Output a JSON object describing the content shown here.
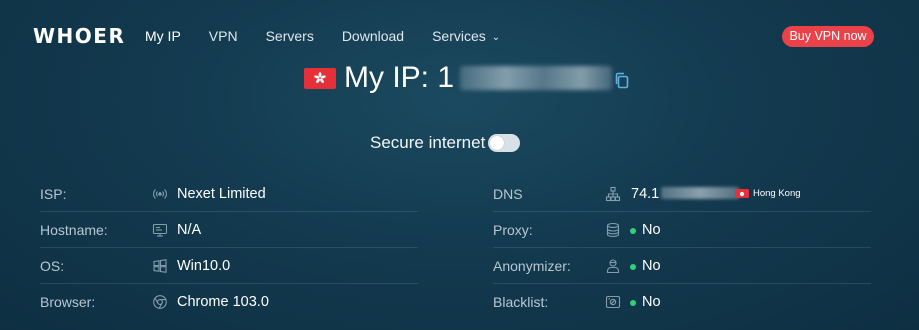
{
  "brand": {
    "logo": "WHOER"
  },
  "nav": {
    "items": [
      {
        "label": "My IP",
        "active": true
      },
      {
        "label": "VPN"
      },
      {
        "label": "Servers"
      },
      {
        "label": "Download"
      },
      {
        "label": "Services"
      }
    ],
    "services_chevron_icon": "chevron-down-icon",
    "cta": "Buy VPN now"
  },
  "ip": {
    "title": "My IP: 1",
    "flag_icon": "flag-hong-kong-icon",
    "copy_icon": "copy-icon"
  },
  "secure": {
    "label": "Secure internet",
    "enabled": false
  },
  "info": {
    "left": [
      {
        "label": "ISP:",
        "value": "Nexet Limited",
        "icon": "signal-icon"
      },
      {
        "label": "Hostname:",
        "value": "N/A",
        "icon": "server-screen-icon"
      },
      {
        "label": "OS:",
        "value": "Win10.0",
        "icon": "windows-icon"
      },
      {
        "label": "Browser:",
        "value": "Chrome 103.0",
        "icon": "browser-icon"
      }
    ],
    "right": [
      {
        "label": "DNS",
        "value": "74.1",
        "icon": "network-icon",
        "country": "Hong Kong"
      },
      {
        "label": "Proxy:",
        "value": "No",
        "icon": "database-icon",
        "status": "ok"
      },
      {
        "label": "Anonymizer:",
        "value": "No",
        "icon": "user-icon",
        "status": "ok"
      },
      {
        "label": "Blacklist:",
        "value": "No",
        "icon": "blacklist-icon",
        "status": "ok"
      }
    ]
  },
  "colors": {
    "accent_red": "#ea4248",
    "status_green": "#2fd17a",
    "background": "#133a4f"
  }
}
